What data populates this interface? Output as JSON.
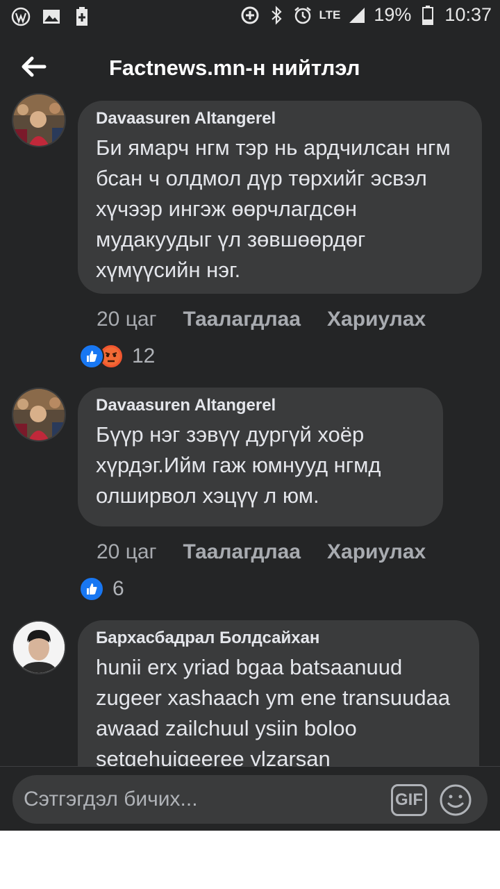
{
  "status_bar": {
    "battery": "19%",
    "time": "10:37",
    "network": "LTE",
    "icons": [
      "wordpress-icon",
      "image-icon",
      "battery-plus-icon",
      "data-saver-icon",
      "bluetooth-icon",
      "alarm-icon",
      "signal-icon",
      "battery-icon"
    ]
  },
  "header": {
    "title": "Factnews.mn-н нийтлэл",
    "back_icon": "arrow-left-icon"
  },
  "comments": [
    {
      "author": "Davaasuren Altangerel",
      "text": "Би ямарч нгм тэр нь ардчилсан нгм бсан ч олдмол дүр төрхийг эсвэл хүчээр ингэж өөрчлагдсөн мудакуудыг үл зөвшөөрдөг хүмүүсийн нэг.",
      "time": "20 цаг",
      "like_label": "Таалагдлаа",
      "reply_label": "Хариулах",
      "reactions": [
        "like",
        "angry"
      ],
      "reaction_count": "12"
    },
    {
      "author": "Davaasuren Altangerel",
      "text": "Бүүр нэг зэвүү дургүй хоёр хүрдэг.Ийм гаж юмнууд нгмд олширвол хэцүү л юм.",
      "time": "20 цаг",
      "like_label": "Таалагдлаа",
      "reply_label": "Хариулах",
      "reactions": [
        "like"
      ],
      "reaction_count": "6"
    },
    {
      "author": "Бархасбадрал Болдсайхан",
      "text": "hunii erx yriad bgaa batsaanuud zugeer xashaach ym ene transuudaa awaad zailchuul ysiin boloo setgehuigeeree ylzarsan"
    }
  ],
  "composer": {
    "placeholder": "Сэтгэгдэл бичих...",
    "gif_label": "GIF",
    "emoji_icon": "smiley-icon"
  },
  "colors": {
    "background": "#242526",
    "bubble": "#3a3b3c",
    "text": "#e4e6eb",
    "secondary_text": "#b0b3b8",
    "like_blue": "#1877f2",
    "angry_orange": "#f0562f"
  }
}
